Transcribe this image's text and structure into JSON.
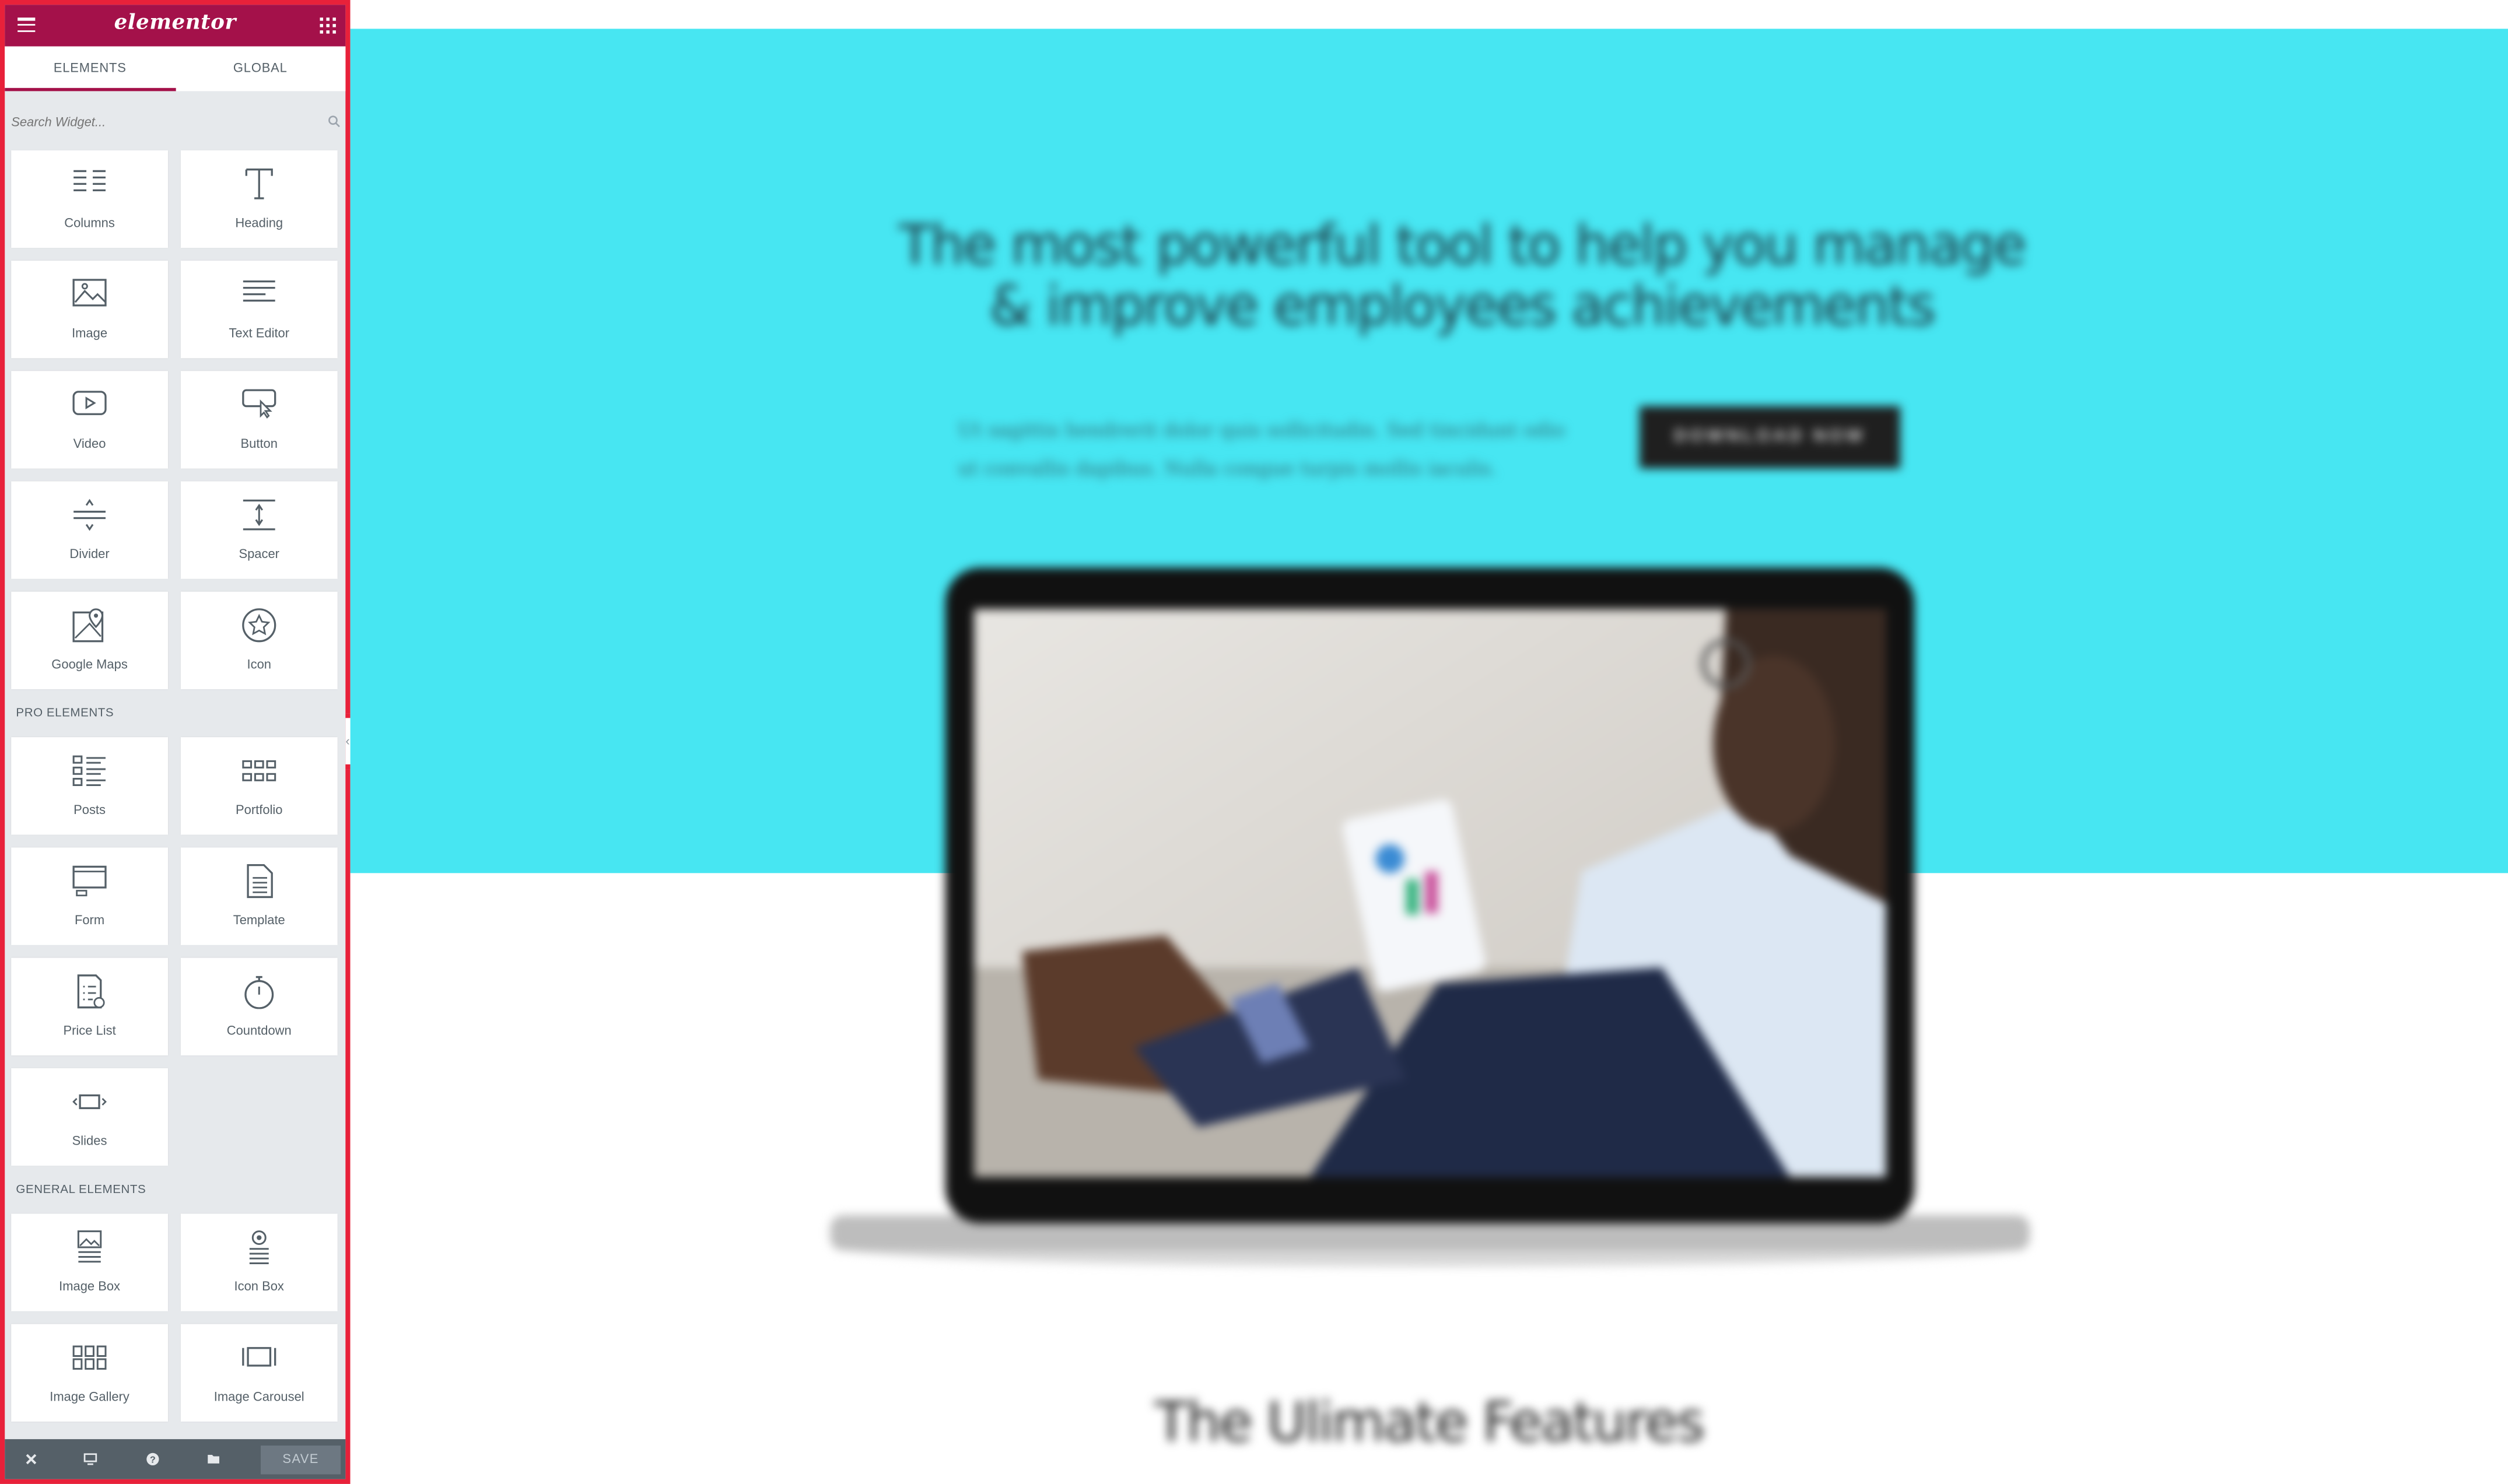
{
  "sidebar": {
    "brand": "elementor",
    "tabs": [
      {
        "label": "ELEMENTS",
        "active": true
      },
      {
        "label": "GLOBAL",
        "active": false
      }
    ],
    "search_placeholder": "Search Widget...",
    "basic_widgets": [
      "Columns",
      "Heading",
      "Image",
      "Text Editor",
      "Video",
      "Button",
      "Divider",
      "Spacer",
      "Google Maps",
      "Icon"
    ],
    "pro_section": "PRO ELEMENTS",
    "pro_widgets": [
      "Posts",
      "Portfolio",
      "Form",
      "Template",
      "Price List",
      "Countdown",
      "Slides"
    ],
    "general_section": "GENERAL ELEMENTS",
    "general_widgets": [
      "Image Box",
      "Icon Box",
      "Image Gallery",
      "Image Carousel"
    ],
    "footer": {
      "save_label": "SAVE"
    },
    "brand_color": "#a4114a",
    "highlight_color": "#e8213a"
  },
  "page": {
    "headline": "The most powerful tool to help you manage & improve employees achievements",
    "subtext": "Ut sagittis hendrerit dolor quis sollicitudin. Sed tincidunt odio ut convallis dapibus. Nulla congue turpis mollis iaculis.",
    "cta": "DOWNLOAD NOW",
    "features_title": "The Ulimate Features",
    "hero_color": "#47e6f2"
  }
}
